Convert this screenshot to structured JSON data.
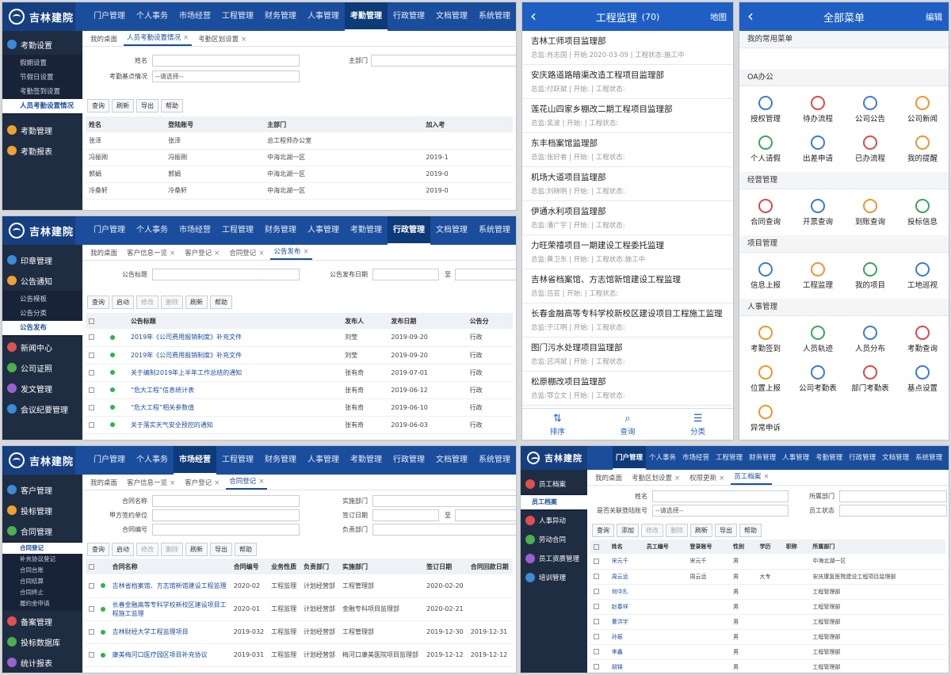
{
  "common": {
    "brand": "吉林建院",
    "nav": [
      "门户管理",
      "个人事务",
      "市场经营",
      "工程管理",
      "财务管理",
      "人事管理",
      "考勤管理",
      "行政管理",
      "文档管理",
      "系统管理"
    ]
  },
  "p1": {
    "sidebar": {
      "g1": "考勤设置",
      "subs": [
        "假期设置",
        "节假日设置",
        "考勤签到设置",
        "人员考勤设置情况"
      ],
      "g2": "考勤管理",
      "g3": "考勤报表"
    },
    "tabs": [
      "我的桌面",
      "人员考勤设置情况",
      "考勤区划设置"
    ],
    "form": {
      "name_label": "姓名",
      "dept_label": "主部门",
      "point_label": "考勤基点情况",
      "select_ph": "--请选择--"
    },
    "buttons": [
      "查询",
      "刷新",
      "导出",
      "帮助"
    ],
    "headers": [
      "姓名",
      "登陆账号",
      "主部门",
      "加入考"
    ],
    "rows": [
      [
        "张泽",
        "张泽",
        "总工程师办公室",
        ""
      ],
      [
        "冯振刚",
        "冯振刚",
        "中海北湖一区",
        "2019-1"
      ],
      [
        "郭娟",
        "郭娟",
        "中海北湖一区",
        "2019-0"
      ],
      [
        "冷桑轩",
        "冷桑轩",
        "中海北湖一区",
        "2019-0"
      ]
    ]
  },
  "p2": {
    "sidebar": {
      "groups": [
        "印章管理",
        "公告通知"
      ],
      "subs": [
        "公告模板",
        "公告分类",
        "公告发布"
      ],
      "groups2": [
        "新闻中心",
        "公司证照",
        "发文管理",
        "会议纪要管理"
      ]
    },
    "tabs": [
      "我的桌面",
      "客户信息一览",
      "客户登记",
      "合同登记",
      "公告发布"
    ],
    "form": {
      "title_label": "公告标题",
      "date_label": "公告发布日期",
      "to": "至"
    },
    "buttons": [
      "查询",
      "启动",
      "修改",
      "删除",
      "刷新",
      "帮助"
    ],
    "headers": [
      "公告标题",
      "发布人",
      "发布日期",
      "公告分"
    ],
    "rows": [
      [
        "2019年《公司费用报销制度》补充文件",
        "刘莹",
        "2019-09-20",
        "行政"
      ],
      [
        "2019年《公司费用报销制度》补充文件",
        "刘莹",
        "2019-09-20",
        "行政"
      ],
      [
        "关于编制2019年上半年工作总结的通知",
        "张有奇",
        "2019-07-01",
        "行政"
      ],
      [
        "“危大工程”信息统计表",
        "张有奇",
        "2019-06-12",
        "行政"
      ],
      [
        "“危大工程”相关参数值",
        "张有奇",
        "2019-06-10",
        "行政"
      ],
      [
        "关于落实天气安全预控的通知",
        "张有奇",
        "2019-06-03",
        "行政"
      ]
    ]
  },
  "p3": {
    "sidebar": {
      "groups": [
        "客户管理",
        "投标管理",
        "合同管理"
      ],
      "subs": [
        "合同登记",
        "补充协议登记",
        "合同台账",
        "合同结算",
        "合同终止",
        "履约金申请"
      ],
      "groups2": [
        "备案管理",
        "投标数据库",
        "统计报表"
      ]
    },
    "tabs": [
      "我的桌面",
      "客户信息一览",
      "客户登记",
      "合同登记"
    ],
    "form": {
      "l1": "合同名称",
      "l2": "甲方签约单位",
      "l3": "合同编号",
      "r1": "实施部门",
      "r2": "签订日期",
      "r3": "负责部门",
      "to": "至"
    },
    "buttons": [
      "查询",
      "启动",
      "修改",
      "删除",
      "刷新",
      "导出",
      "帮助"
    ],
    "headers": [
      "合同名称",
      "合同编号",
      "业务性质",
      "负责部门",
      "实施部门",
      "签订日期",
      "合同回款日期"
    ],
    "rows": [
      [
        "吉林省档案馆、方志馆新馆建设工程监理",
        "2020-02",
        "工程监理",
        "计划经营部",
        "工程管理部",
        "2020-02-20",
        ""
      ],
      [
        "长春金融高等专科学校新校区建设项目工程施工监理",
        "2020-01",
        "工程监理",
        "计划经营部",
        "金融专科项目监理部",
        "2020-02-21",
        ""
      ],
      [
        "吉林财经大学工程监理项目",
        "2019-032",
        "工程监理",
        "计划经营部",
        "工程管理部",
        "2019-12-30",
        "2019-12-31"
      ],
      [
        "康美梅河口医疗园区项目补充协议",
        "2019-031",
        "工程监理",
        "计划经营部",
        "梅河口康美医院项目监理部",
        "2019-12-12",
        "2019-12-12"
      ]
    ]
  },
  "p4": {
    "sidebar": {
      "groups": [
        "员工档案"
      ],
      "subs": [
        "员工档案"
      ],
      "groups2": [
        "人事异动",
        "劳动合同",
        "员工资质管理",
        "培训管理"
      ]
    },
    "tabs": [
      "我的桌面",
      "考勤区划设置",
      "权限更新",
      "员工档案"
    ],
    "form": {
      "name_label": "姓名",
      "multi_label": "是否关联登陆账号",
      "select_ph": "--请选择--",
      "dept_label": "所属部门",
      "status_label": "员工状态"
    },
    "buttons": [
      "查询",
      "添加",
      "修改",
      "删除",
      "刷新",
      "导出",
      "帮助"
    ],
    "headers": [
      "姓名",
      "员工编号",
      "登录账号",
      "性别",
      "学历",
      "职称",
      "所属部门"
    ],
    "rows": [
      [
        "宋元千",
        "",
        "宋元千",
        "男",
        "",
        "",
        "中海北湖一区"
      ],
      [
        "周云远",
        "",
        "周云远",
        "男",
        "大专",
        "",
        "安庆康复医院建设工程项目监理部"
      ],
      [
        "何中扎",
        "",
        "",
        "男",
        "",
        "",
        "工程管理部"
      ],
      [
        "赵春祥",
        "",
        "",
        "男",
        "",
        "",
        "工程管理部"
      ],
      [
        "曹洪宇",
        "",
        "",
        "男",
        "",
        "",
        "工程管理部"
      ],
      [
        "孙振",
        "",
        "",
        "男",
        "",
        "",
        "工程管理部"
      ],
      [
        "李鑫",
        "",
        "",
        "男",
        "",
        "",
        "工程管理部"
      ],
      [
        "胡锦",
        "",
        "",
        "男",
        "",
        "",
        "工程管理部"
      ]
    ]
  },
  "m1": {
    "title": "工程监理",
    "count": "(70)",
    "map": "地图",
    "projects": [
      {
        "name": "吉林工师项目监理部",
        "meta": "总监:肖志国 | 开始:2020-03-09 | 工程状态:施工中"
      },
      {
        "name": "安庆路道路暗渠改造工程项目监理部",
        "meta": "总监:付跃斌 | 开始: | 工程状态:"
      },
      {
        "name": "莲花山四家乡棚改二期工程项目监理部",
        "meta": "总监:吴波 | 开始: | 工程状态:"
      },
      {
        "name": "东丰档案馆监理部",
        "meta": "总监:张好者 | 开始: | 工程状态:"
      },
      {
        "name": "机场大道项目监理部",
        "meta": "总监:刘晓明 | 开始: | 工程状态:"
      },
      {
        "name": "伊通水利项目监理部",
        "meta": "总监:潘广宇 | 开始: | 工程状态:"
      },
      {
        "name": "力旺荣禧项目一期建设工程委托监理",
        "meta": "总监:黄卫东 | 开始: | 工程状态:施工中"
      },
      {
        "name": "吉林省档案馆、方志馆新馆建设工程监理",
        "meta": "总监:吕芸 | 开始: | 工程状态:"
      },
      {
        "name": "长春金融高等专科学校新校区建设项目工程施工监理",
        "meta": "总监:于江明 | 开始: | 工程状态:"
      },
      {
        "name": "图门污水处理项目监理部",
        "meta": "总监:吕鸿斌 | 开始: | 工程状态:"
      },
      {
        "name": "松原棚改项目监理部",
        "meta": "总监:鄂立文 | 开始: | 工程状态:"
      }
    ],
    "footer": [
      "排序",
      "查询",
      "分类"
    ]
  },
  "m2": {
    "title": "全部菜单",
    "edit": "编辑",
    "sections": [
      {
        "title": "我的常用菜单",
        "items": []
      },
      {
        "title": "OA办公",
        "items": [
          "授权管理",
          "待办流程",
          "公司公告",
          "公司新闻",
          "个人请假",
          "出差申请",
          "已办流程",
          "我的提醒"
        ]
      },
      {
        "title": "经营管理",
        "items": [
          "合同查询",
          "开票查询",
          "到账查询",
          "投标信息"
        ]
      },
      {
        "title": "项目管理",
        "items": [
          "信息上报",
          "工程监理",
          "我的项目",
          "工地巡视"
        ]
      },
      {
        "title": "人事管理",
        "items": [
          "考勤签到",
          "人员轨迹",
          "人员分布",
          "考勤查询",
          "位置上报",
          "公司考勤表",
          "部门考勤表",
          "基点设置",
          "异常申诉"
        ]
      }
    ]
  }
}
